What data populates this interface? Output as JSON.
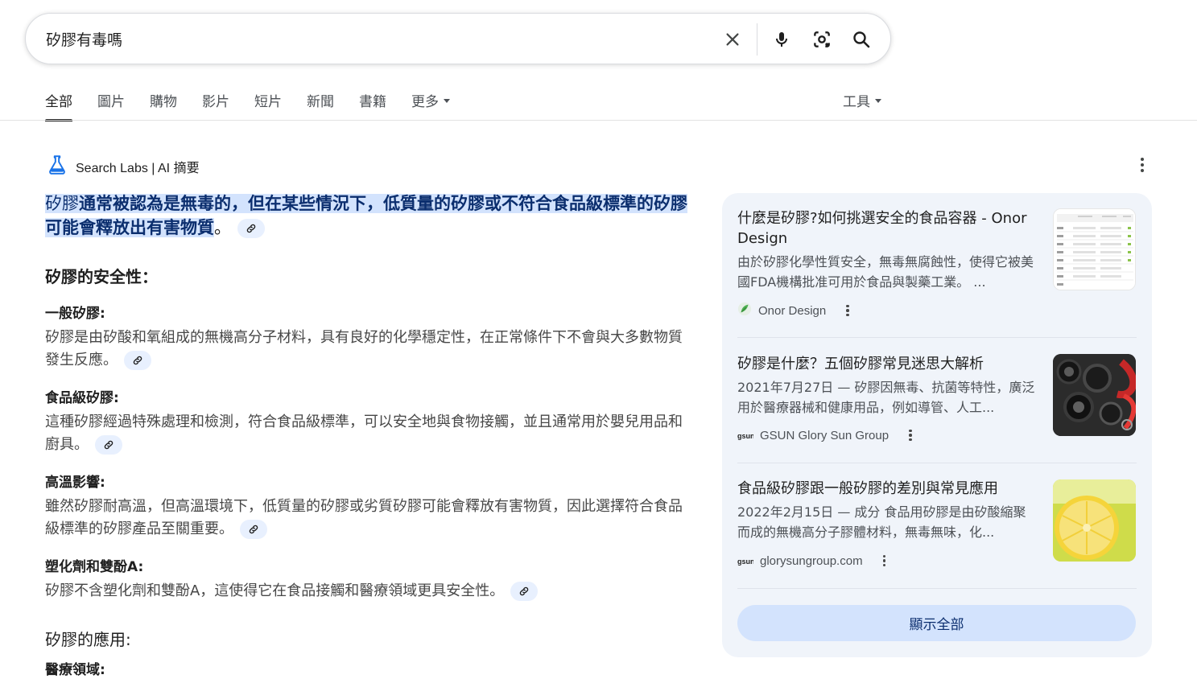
{
  "search": {
    "query": "矽膠有毒嗎",
    "clear_icon": "close-icon",
    "voice_icon": "mic-icon",
    "lens_icon": "camera-lens-icon",
    "search_icon": "search-icon"
  },
  "tabs": [
    {
      "label": "全部",
      "active": true
    },
    {
      "label": "圖片"
    },
    {
      "label": "購物"
    },
    {
      "label": "影片"
    },
    {
      "label": "短片"
    },
    {
      "label": "新聞"
    },
    {
      "label": "書籍"
    },
    {
      "label": "更多"
    }
  ],
  "tools_label": "工具",
  "ai_overview": {
    "header": "Search Labs | AI 摘要",
    "lead_prefix": "矽膠",
    "lead_highlight": "通常被認為是無毒的，但在某些情況下，低質量的矽膠或不符合食品級標準的矽膠可能會釋放出有害物質",
    "lead_suffix": "。",
    "section1": "矽膠的安全性：",
    "items": [
      {
        "title": "一般矽膠:",
        "body": "矽膠是由矽酸和氧組成的無機高分子材料，具有良好的化學穩定性，在正常條件下不會與大多數物質發生反應。"
      },
      {
        "title": "食品級矽膠:",
        "body": "這種矽膠經過特殊處理和檢測，符合食品級標準，可以安全地與食物接觸，並且通常用於嬰兒用品和廚具。"
      },
      {
        "title": "高溫影響:",
        "body": "雖然矽膠耐高溫，但高溫環境下，低質量的矽膠或劣質矽膠可能會釋放有害物質，因此選擇符合食品級標準的矽膠產品至關重要。"
      },
      {
        "title": "塑化劑和雙酚A:",
        "body": "矽膠不含塑化劑和雙酚A，這使得它在食品接觸和醫療領域更具安全性。"
      }
    ],
    "section2": "矽膠的應用:",
    "item5_title": "醫療領域:"
  },
  "sources": [
    {
      "title": "什麼是矽膠?如何挑選安全的食品容器 - Onor Design",
      "snippet": "由於矽膠化學性質安全，無毒無腐蝕性，使得它被美國FDA機構批准可用於食品與製藥工業。 ...",
      "site": "Onor Design"
    },
    {
      "title": "矽膠是什麼？五個矽膠常見迷思大解析",
      "snippet": "2021年7月27日 — 矽膠因無毒、抗菌等特性，廣泛用於醫療器械和健康用品，例如導管、人工...",
      "site": "GSUN Glory Sun Group"
    },
    {
      "title": "食品級矽膠跟一般矽膠的差別與常見應用",
      "snippet": "2022年2月15日 — 成分 食品用矽膠是由矽酸縮聚而成的無機高分子膠體材料，無毒無味，化...",
      "site": "glorysungroup.com"
    }
  ],
  "show_all_label": "顯示全部",
  "colors": {
    "accent": "#0b57d0",
    "highlight_bg": "#d3e3fd",
    "panel_bg": "#f0f4fa"
  }
}
